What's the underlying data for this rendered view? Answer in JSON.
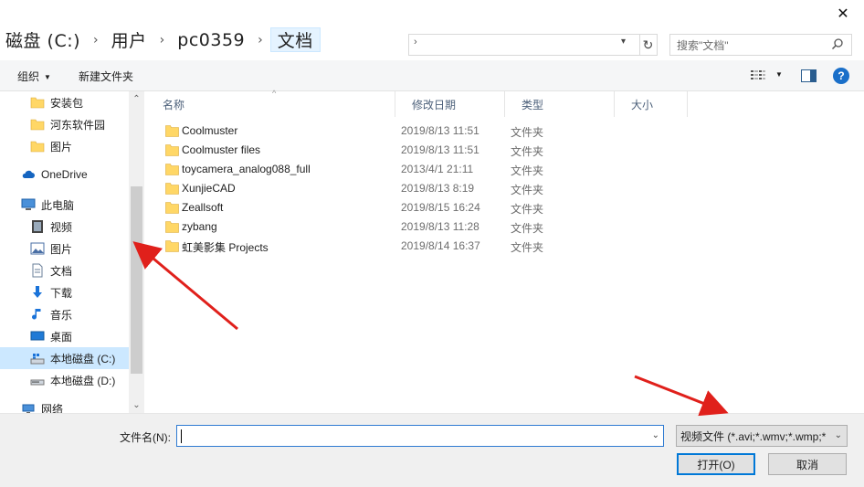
{
  "window": {
    "close_glyph": "✕"
  },
  "breadcrumb": {
    "items": [
      "磁盘 (C:)",
      "用户",
      "pc0359",
      "文档"
    ],
    "separator": "›"
  },
  "search": {
    "placeholder": "搜索\"文档\""
  },
  "toolbar": {
    "organize_label": "组织",
    "new_folder_label": "新建文件夹",
    "help_glyph": "?"
  },
  "nav": {
    "items": [
      {
        "label": "安装包",
        "icon": "folder-icon"
      },
      {
        "label": "河东软件园",
        "icon": "folder-icon"
      },
      {
        "label": "图片",
        "icon": "folder-icon"
      },
      {
        "label": "OneDrive",
        "icon": "cloud-icon"
      },
      {
        "label": "此电脑",
        "icon": "computer-icon"
      },
      {
        "label": "视频",
        "icon": "video-icon"
      },
      {
        "label": "图片",
        "icon": "pictures-icon"
      },
      {
        "label": "文档",
        "icon": "documents-icon"
      },
      {
        "label": "下载",
        "icon": "download-icon"
      },
      {
        "label": "音乐",
        "icon": "music-icon"
      },
      {
        "label": "桌面",
        "icon": "desktop-icon"
      },
      {
        "label": "本地磁盘 (C:)",
        "icon": "drive-c-icon",
        "selected": true
      },
      {
        "label": "本地磁盘 (D:)",
        "icon": "drive-d-icon"
      },
      {
        "label": "网络",
        "icon": "network-icon"
      }
    ]
  },
  "columns": [
    "名称",
    "修改日期",
    "类型",
    "大小"
  ],
  "files": [
    {
      "name": "Coolmuster",
      "date": "2019/8/13 11:51",
      "type": "文件夹"
    },
    {
      "name": "Coolmuster files",
      "date": "2019/8/13 11:51",
      "type": "文件夹"
    },
    {
      "name": "toycamera_analog088_full",
      "date": "2013/4/1 21:11",
      "type": "文件夹"
    },
    {
      "name": "XunjieCAD",
      "date": "2019/8/13 8:19",
      "type": "文件夹"
    },
    {
      "name": "Zeallsoft",
      "date": "2019/8/15 16:24",
      "type": "文件夹"
    },
    {
      "name": "zybang",
      "date": "2019/8/13 11:28",
      "type": "文件夹"
    },
    {
      "name": "虹美影集 Projects",
      "date": "2019/8/14 16:37",
      "type": "文件夹"
    }
  ],
  "footer": {
    "filename_label": "文件名(N):",
    "filename_value": "",
    "filter_value": "视频文件 (*.avi;*.wmv;*.wmp;*",
    "open_label": "打开(O)",
    "cancel_label": "取消"
  },
  "colors": {
    "folder": "#ffd766",
    "selection": "#cce8ff",
    "accent": "#0078d7",
    "annotation_arrow": "#e0201b"
  }
}
